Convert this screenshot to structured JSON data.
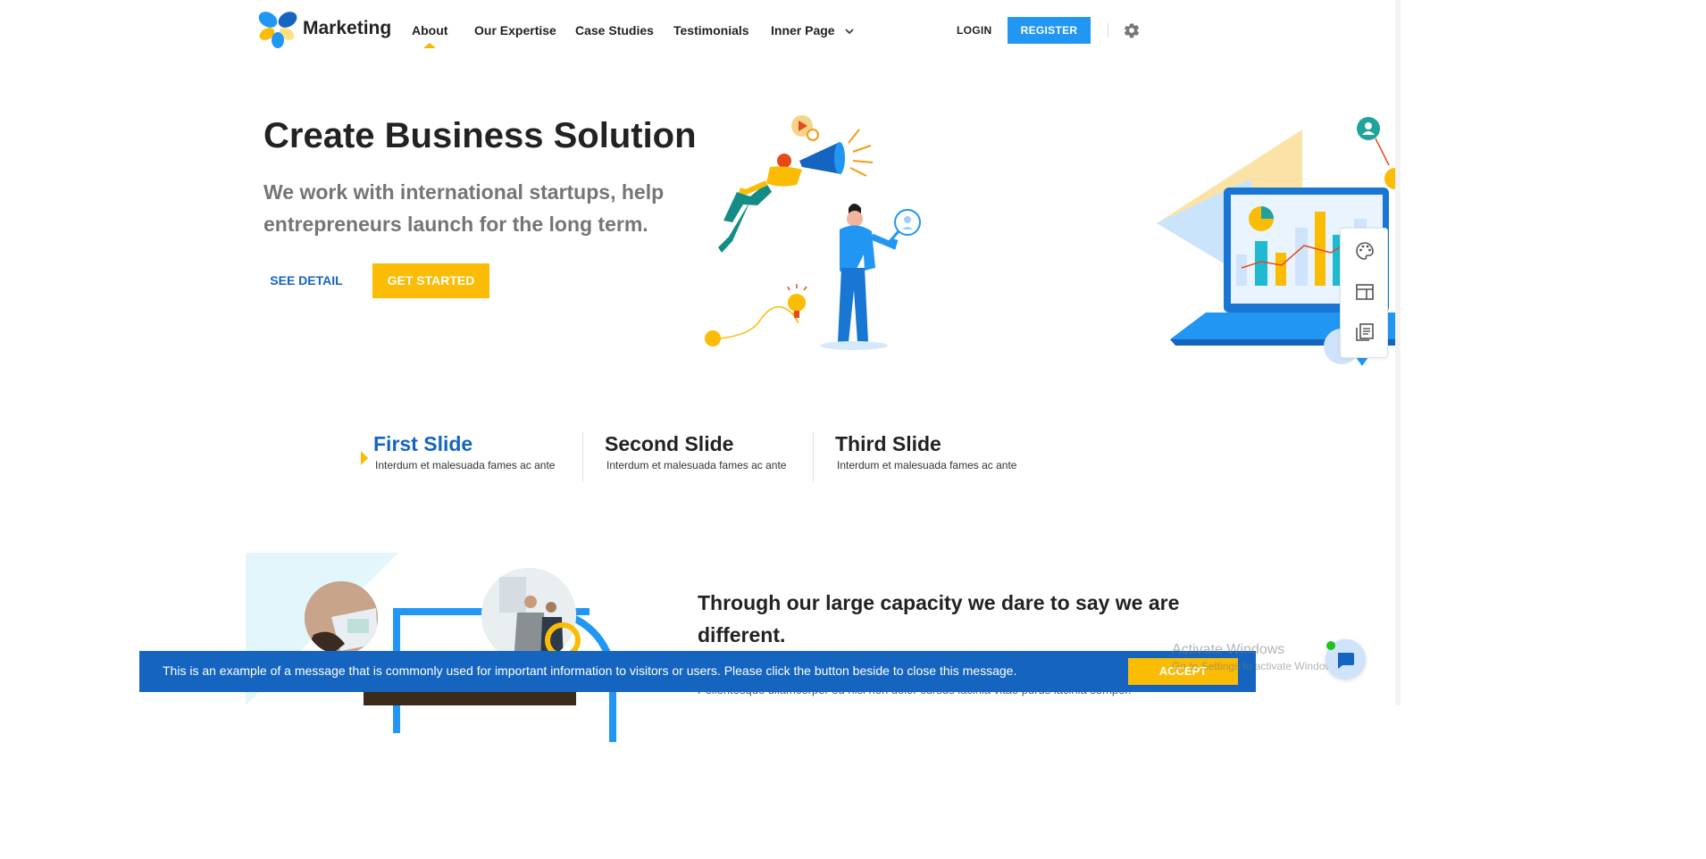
{
  "brand": {
    "name": "Marketing"
  },
  "nav": {
    "items": [
      {
        "label": "About"
      },
      {
        "label": "Our Expertise"
      },
      {
        "label": "Case Studies"
      },
      {
        "label": "Testimonials"
      },
      {
        "label": "Inner Page"
      }
    ],
    "login": "LOGIN",
    "register": "REGISTER"
  },
  "hero": {
    "title": "Create Business Solution",
    "subtitle": "We work with international startups, help entrepreneurs launch for the long term.",
    "see_detail": "SEE DETAIL",
    "get_started": "GET STARTED"
  },
  "slides": [
    {
      "title": "First Slide",
      "desc": "Interdum et malesuada fames ac ante"
    },
    {
      "title": "Second Slide",
      "desc": "Interdum et malesuada fames ac ante"
    },
    {
      "title": "Third Slide",
      "desc": "Interdum et malesuada fames ac ante"
    }
  ],
  "section": {
    "title": "Through our large capacity we dare to say we are different.",
    "partial_text": "Pellentesque ullamcorper eu nisi non dolor cursus lacinia vitae purus lacinia semper."
  },
  "cookie": {
    "message": "This is an example of a message that is commonly used for important information to visitors or users. Please click the button beside to close this message.",
    "accept": "ACCEPT"
  },
  "watermark": {
    "title": "Activate Windows",
    "subtitle": "Go to Settings to activate Windows."
  },
  "colors": {
    "primary": "#2196f3",
    "primary_dark": "#1565c0",
    "accent": "#fbbc05"
  },
  "icons": {
    "settings": "gear-icon",
    "palette": "palette-icon",
    "layout": "layout-icon",
    "docs": "document-icon",
    "chat": "chat-icon"
  }
}
